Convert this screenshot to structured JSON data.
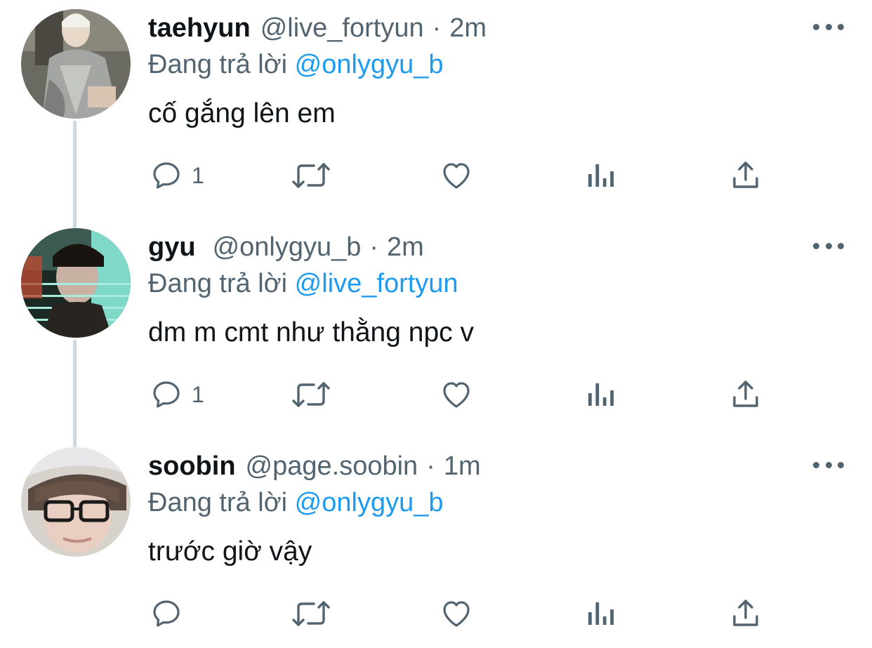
{
  "reply_prefix": "Đang trả lời",
  "separator": "·",
  "colors": {
    "text": "#0f1419",
    "secondary": "#536471",
    "link": "#1d9bf0",
    "thread_line": "#cfd9de"
  },
  "icons": {
    "reply": "comment-bubble-icon",
    "retweet": "retweet-icon",
    "like": "heart-icon",
    "views": "bar-chart-icon",
    "share": "share-upload-icon",
    "more": "more-dots-icon"
  },
  "tweets": [
    {
      "display_name": "taehyun",
      "handle": "@live_fortyun",
      "time": "2m",
      "reply_to": "@onlygyu_b",
      "text": "cố gắng lên em",
      "reply_count": "1"
    },
    {
      "display_name": "gyu",
      "handle": "@onlygyu_b",
      "time": "2m",
      "reply_to": "@live_fortyun",
      "text": "dm m cmt như thằng npc v",
      "reply_count": "1"
    },
    {
      "display_name": "soobin",
      "handle": "@page.soobin",
      "time": "1m",
      "reply_to": "@onlygyu_b",
      "text": "trước giờ vậy",
      "reply_count": ""
    }
  ]
}
